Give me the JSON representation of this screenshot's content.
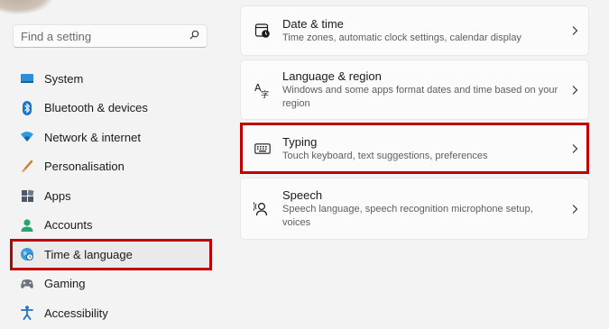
{
  "search": {
    "placeholder": "Find a setting"
  },
  "sidebar": {
    "items": [
      {
        "label": "System"
      },
      {
        "label": "Bluetooth & devices"
      },
      {
        "label": "Network & internet"
      },
      {
        "label": "Personalisation"
      },
      {
        "label": "Apps"
      },
      {
        "label": "Accounts"
      },
      {
        "label": "Time & language"
      },
      {
        "label": "Gaming"
      },
      {
        "label": "Accessibility"
      }
    ],
    "selected": "Time & language"
  },
  "main": {
    "cards": [
      {
        "title": "Date & time",
        "desc": "Time zones, automatic clock settings, calendar display"
      },
      {
        "title": "Language & region",
        "desc": "Windows and some apps format dates and time based on your region"
      },
      {
        "title": "Typing",
        "desc": "Touch keyboard, text suggestions, preferences"
      },
      {
        "title": "Speech",
        "desc": "Speech language, speech recognition microphone setup, voices"
      }
    ]
  },
  "colors": {
    "highlight": "#c00000",
    "accent": "#0067c0"
  }
}
